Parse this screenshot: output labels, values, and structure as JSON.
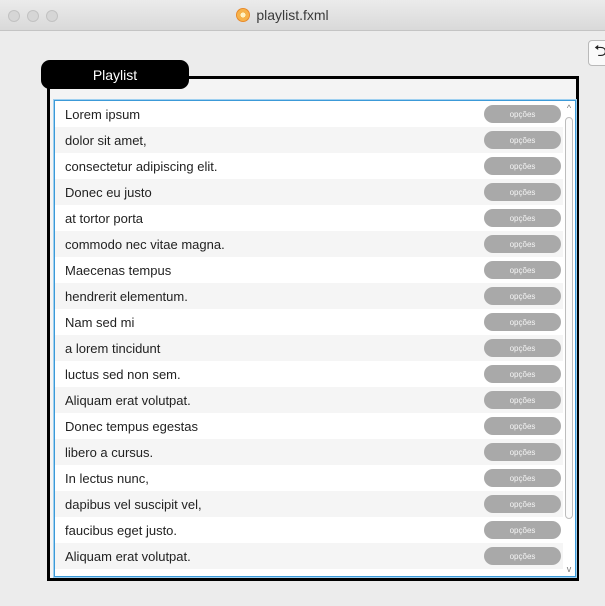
{
  "window": {
    "title": "playlist.fxml",
    "icons": {
      "file": "fxml-file-icon",
      "undo": "undo-icon"
    }
  },
  "toolbar": {
    "undo_label": "⮌"
  },
  "panel": {
    "title": "Playlist"
  },
  "list": {
    "option_label": "opções",
    "items": [
      "Lorem ipsum",
      "dolor sit amet,",
      "consectetur adipiscing elit.",
      "Donec eu justo",
      "at tortor porta",
      "commodo nec vitae magna.",
      "Maecenas tempus",
      "hendrerit elementum.",
      "Nam sed mi",
      "a lorem tincidunt",
      "luctus sed non sem.",
      "Aliquam erat volutpat.",
      "Donec tempus egestas",
      "libero a cursus.",
      "In lectus nunc,",
      "dapibus vel suscipit vel,",
      "faucibus eget justo.",
      "Aliquam erat volutpat."
    ]
  },
  "scroll": {
    "up_arrow": "^",
    "down_arrow": "v"
  }
}
